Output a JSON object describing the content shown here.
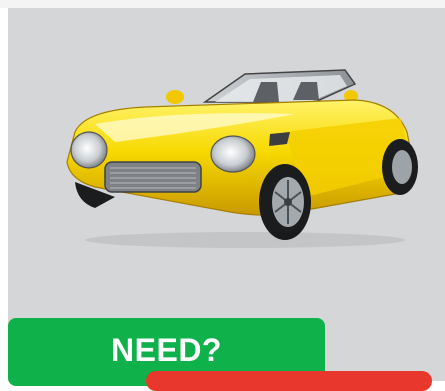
{
  "promo": {
    "image_subject": "yellow-convertible-car",
    "cta_primary_label": "NEED?",
    "colors": {
      "panel_bg": "#d5d6d8",
      "cta_primary": "#0fb14b",
      "cta_secondary": "#e8372c",
      "car_body": "#f5d800"
    }
  }
}
